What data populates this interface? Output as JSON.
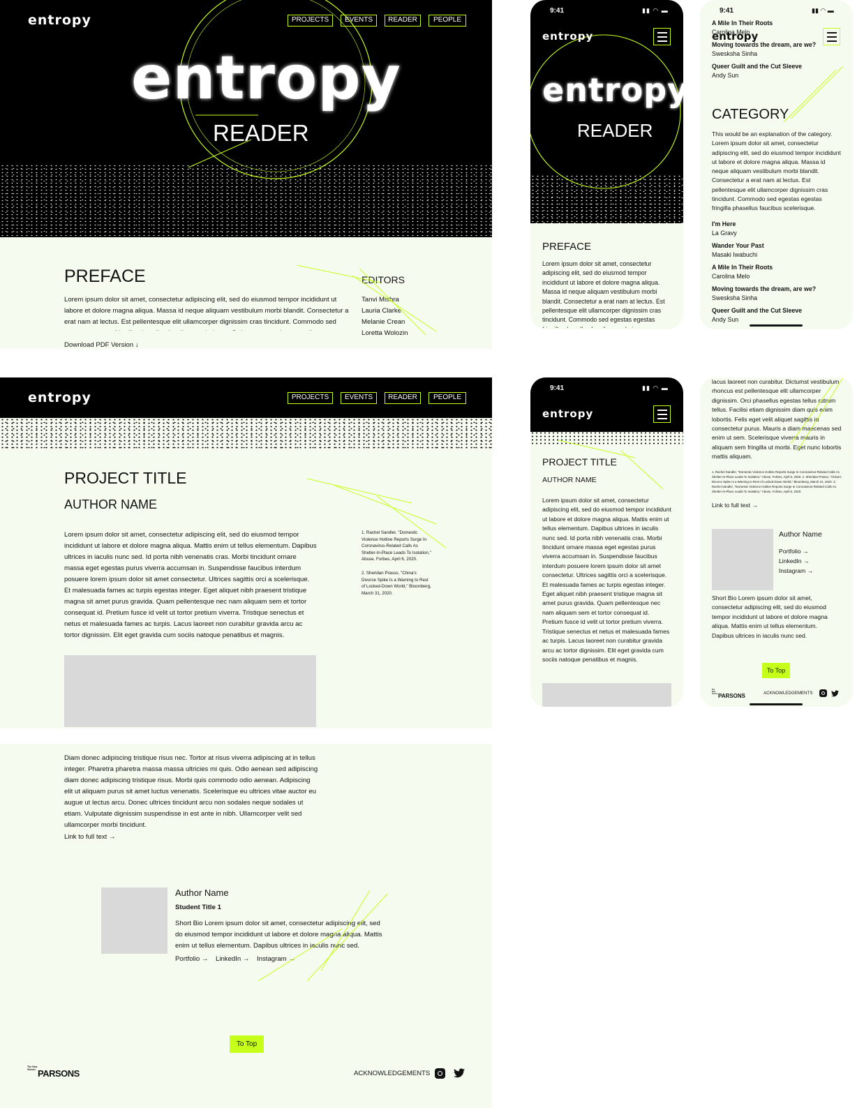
{
  "brand": {
    "logo": "entropy",
    "hero_word": "entropy",
    "hero_subtitle": "READER",
    "accent": "#c6ff1a"
  },
  "nav": {
    "items": [
      "PROJECTS",
      "EVENTS",
      "READER",
      "PEOPLE"
    ]
  },
  "status_bar": {
    "time": "9:41"
  },
  "preface": {
    "heading": "PREFACE",
    "body": "Lorem ipsum dolor sit amet, consectetur adipiscing elit, sed do eiusmod tempor incididunt ut labore et dolore magna aliqua. Massa id neque aliquam vestibulum morbi blandit. Consectetur a erat nam at lectus. Est pellentesque elit ullamcorper dignissim cras tincidunt. Commodo sed egestas egestas fringilla phasellus faucibus scelerisque. Dui accumsan sit amet nulla.",
    "mobile_body": "Lorem ipsum dolor sit amet, consectetur adipiscing elit, sed do eiusmod tempor incididunt ut labore et dolore magna aliqua. Massa id neque aliquam vestibulum morbi blandit. Consectetur a erat nam at lectus. Est pellentesque elit ullamcorper dignissim cras tincidunt. Commodo sed egestas egestas fringilla phasellus faucibus scelerisque.",
    "download": "Download PDF Version ↓"
  },
  "editors": {
    "heading": "EDITORS",
    "names": [
      "Tanvi Mishra",
      "Lauria Clarke",
      "Melanie Crean",
      "Loretta Wolozin"
    ]
  },
  "category": {
    "heading": "CATEGORY",
    "body": "This would be an explanation of the category. Lorem ipsum dolor sit amet, consectetur adipiscing elit, sed do eiusmod tempor incididunt ut labore et dolore magna aliqua. Massa id neque aliquam vestibulum morbi blandit. Consectetur a erat nam at lectus. Est pellentesque elit ullamcorper dignissim cras tincidunt. Commodo sed egestas egestas fringilla phasellus faucibus scelerisque.",
    "top_items": [
      {
        "title": "A Mile In Their Roots",
        "author": "Carolina Melo"
      },
      {
        "title": "Moving towards the dream, are we?",
        "author": "Swesksha Sinha"
      },
      {
        "title": "Queer Guilt and the Cut Sleeve",
        "author": "Andy Sun"
      }
    ],
    "items": [
      {
        "title": "I'm Here",
        "author": "La Gravy"
      },
      {
        "title": "Wander Your Past",
        "author": "Masaki Iwabuchi"
      },
      {
        "title": "A Mile In Their Roots",
        "author": "Carolina Melo"
      },
      {
        "title": "Moving towards the dream, are we?",
        "author": "Swesksha Sinha"
      },
      {
        "title": "Queer Guilt and the Cut Sleeve",
        "author": "Andy Sun"
      }
    ]
  },
  "project": {
    "title": "PROJECT TITLE",
    "author": "AUTHOR NAME",
    "body": "Lorem ipsum dolor sit amet, consectetur adipiscing elit, sed do eiusmod tempor incididunt ut labore et dolore magna aliqua. Mattis enim ut tellus elementum. Dapibus ultrices in iaculis nunc sed. Id porta nibh venenatis cras. Morbi tincidunt ornare massa eget egestas purus viverra accumsan in. Suspendisse faucibus interdum posuere lorem ipsum dolor sit amet consectetur. Ultrices sagittis orci a scelerisque. Et malesuada fames ac turpis egestas integer. Eget aliquet nibh praesent tristique magna sit amet purus gravida. Quam pellentesque nec nam aliquam sem et tortor consequat id. Pretium fusce id velit ut tortor pretium viverra. Tristique senectus et netus et malesuada fames ac turpis. Lacus laoreet non curabitur gravida arcu ac tortor dignissim. Elit eget gravida cum sociis natoque penatibus et magnis.",
    "body2": "Diam donec adipiscing tristique risus nec. Tortor at risus viverra adipiscing at in tellus integer. Pharetra pharetra massa massa ultricies mi quis. Odio aenean sed adipiscing diam donec adipiscing tristique risus. Morbi quis commodo odio aenean. Adipiscing elit ut aliquam purus sit amet luctus venenatis. Scelerisque eu ultrices vitae auctor eu augue ut lectus arcu. Donec ultrices tincidunt arcu non sodales neque sodales ut etiam. Vulputate dignissim suspendisse in est ante in nibh. Ullamcorper velit sed ullamcorper morbi tincidunt.",
    "mobile_tail": "lacus laoreet non curabitur. Dictumst vestibulum rhoncus est pellentesque elit ullamcorper dignissim. Orci phasellus egestas tellus rutrum tellus. Facilisi etiam dignissim diam quis enim lobortis. Felis eget velit aliquet sagittis id consectetur purus. Mauris a diam maecenas sed enim ut sem. Scelerisque viverra mauris in aliquam sem fringilla ut morbi. Eget nunc lobortis mattis aliquam.",
    "footnote1": "1. Rachel Sandler, \"Domestic Violence Hotline Reports Surge In Coronavirus-Related Calls As Shelter-In-Place Leads To Isolation,\" Abuse, Forbes, April 6, 2020.",
    "footnote2": "2. Sheridan Prasso, \"China's Divorce Spike Is a Warning to Rest of Locked-Down World,\" Bloomberg, March 31, 2020.",
    "mobile_footnotes": "1. Rachel Sandler, \"Domestic Violence Hotline Reports Surge In Coronavirus-Related Calls As Shelter-In-Place Leads To Isolation,\" Abuse, Forbes, April 6, 2020. 2. Sheridan Prasso, \"China's Divorce Spike Is a Warning to Rest of Locked-Down World,\" Bloomberg, March 31, 2020. 3. Rachel Sandler, \"Domestic Violence Hotline Reports Surge In Coronavirus-Related Calls As Shelter-In-Place Leads To Isolation,\" Abuse, Forbes, April 6, 2020.",
    "link_full": "Link to full text →"
  },
  "author_card": {
    "name": "Author Name",
    "student_title": "Student Title 1",
    "bio": "Short Bio Lorem ipsum dolor sit amet, consectetur adipiscing elit, sed do eiusmod tempor incididunt ut labore et dolore magna aliqua. Mattis enim ut tellus elementum. Dapibus ultrices in iaculis nunc sed.",
    "portfolio": "Portfolio →",
    "linkedin": "LinkedIn →",
    "instagram": "Instagram →"
  },
  "footer": {
    "to_top": "To Top",
    "acknowledgements": "ACKNOWLEDGEMENTS",
    "parsons_small": "The New School",
    "parsons": "PARSONS"
  }
}
